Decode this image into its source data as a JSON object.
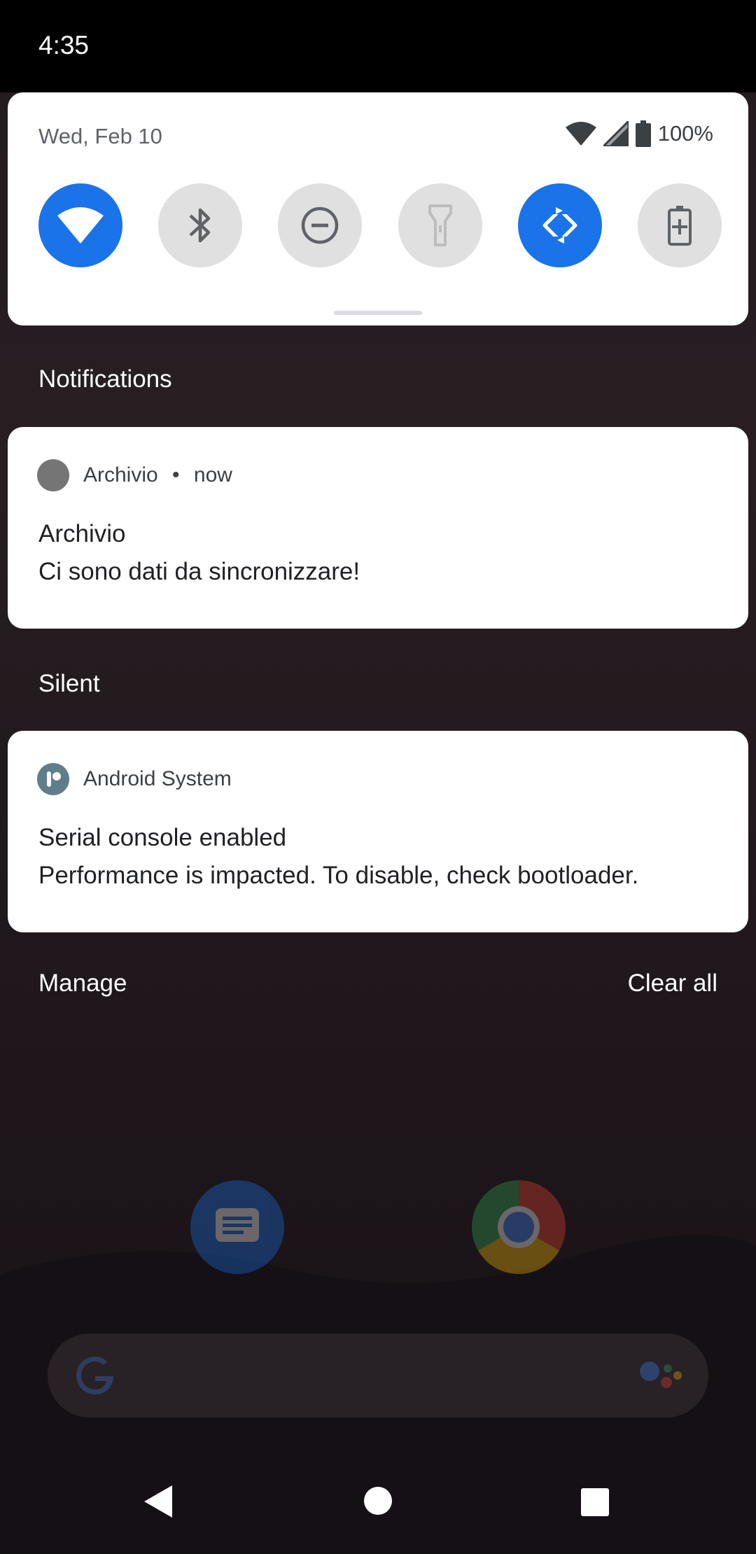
{
  "status_bar": {
    "time": "4:35"
  },
  "quick_settings": {
    "date": "Wed, Feb 10",
    "battery": "100%",
    "tiles": [
      {
        "name": "wifi",
        "icon": "wifi-icon",
        "active": true
      },
      {
        "name": "bluetooth",
        "icon": "bluetooth-icon",
        "active": false
      },
      {
        "name": "do-not-disturb",
        "icon": "do-not-disturb-icon",
        "active": false
      },
      {
        "name": "flashlight",
        "icon": "flashlight-icon",
        "active": false
      },
      {
        "name": "auto-rotate",
        "icon": "auto-rotate-icon",
        "active": true
      },
      {
        "name": "battery-saver",
        "icon": "battery-saver-icon",
        "active": false
      }
    ]
  },
  "notifications": {
    "header": "Notifications",
    "items": [
      {
        "app": "Archivio",
        "time": "now",
        "title": "Archivio",
        "text": "Ci sono dati da sincronizzare!"
      }
    ]
  },
  "silent": {
    "header": "Silent",
    "items": [
      {
        "app": "Android System",
        "title": "Serial console enabled",
        "text": "Performance is impacted. To disable, check bootloader."
      }
    ]
  },
  "footer": {
    "manage": "Manage",
    "clear_all": "Clear all"
  },
  "colors": {
    "accent": "#1a73e8",
    "tile_off": "#e0e0e0"
  }
}
